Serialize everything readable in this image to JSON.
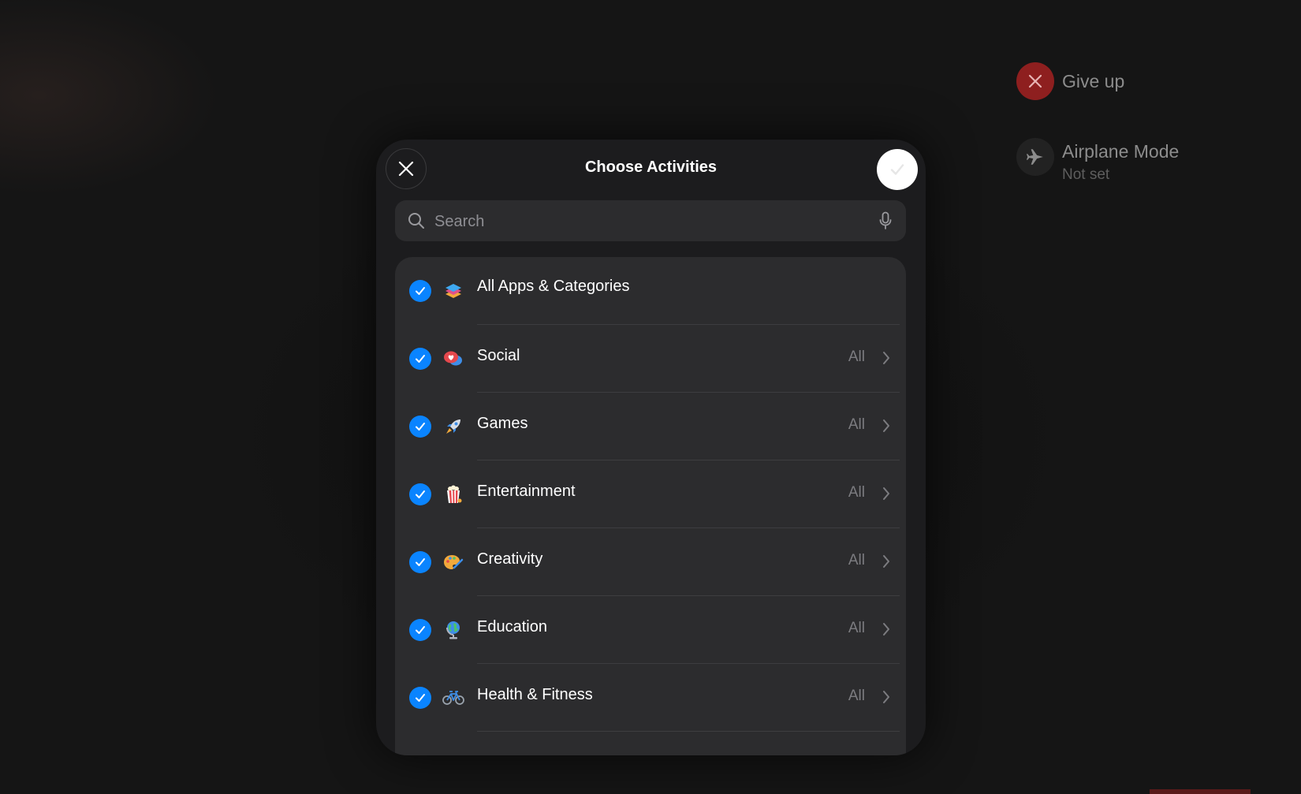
{
  "side_panel": {
    "give_up": {
      "label": "Give up",
      "icon": "x-icon",
      "color": "#8e1f1f"
    },
    "airplane": {
      "label": "Airplane Mode",
      "sub": "Not set",
      "icon": "airplane-icon"
    }
  },
  "modal": {
    "title": "Choose Activities",
    "close_icon": "close-icon",
    "done_icon": "checkmark-icon",
    "search": {
      "placeholder": "Search",
      "value": ""
    },
    "accent": "#0a84ff",
    "rows": [
      {
        "label": "All Apps & Categories",
        "value": "",
        "icon": "stacked-layers-icon",
        "checked": true
      },
      {
        "label": "Social",
        "value": "All",
        "icon": "chat-heart-icon",
        "checked": true
      },
      {
        "label": "Games",
        "value": "All",
        "icon": "rocket-icon",
        "checked": true
      },
      {
        "label": "Entertainment",
        "value": "All",
        "icon": "popcorn-icon",
        "checked": true
      },
      {
        "label": "Creativity",
        "value": "All",
        "icon": "palette-icon",
        "checked": true
      },
      {
        "label": "Education",
        "value": "All",
        "icon": "globe-icon",
        "checked": true
      },
      {
        "label": "Health & Fitness",
        "value": "All",
        "icon": "bicycle-icon",
        "checked": true
      }
    ]
  }
}
